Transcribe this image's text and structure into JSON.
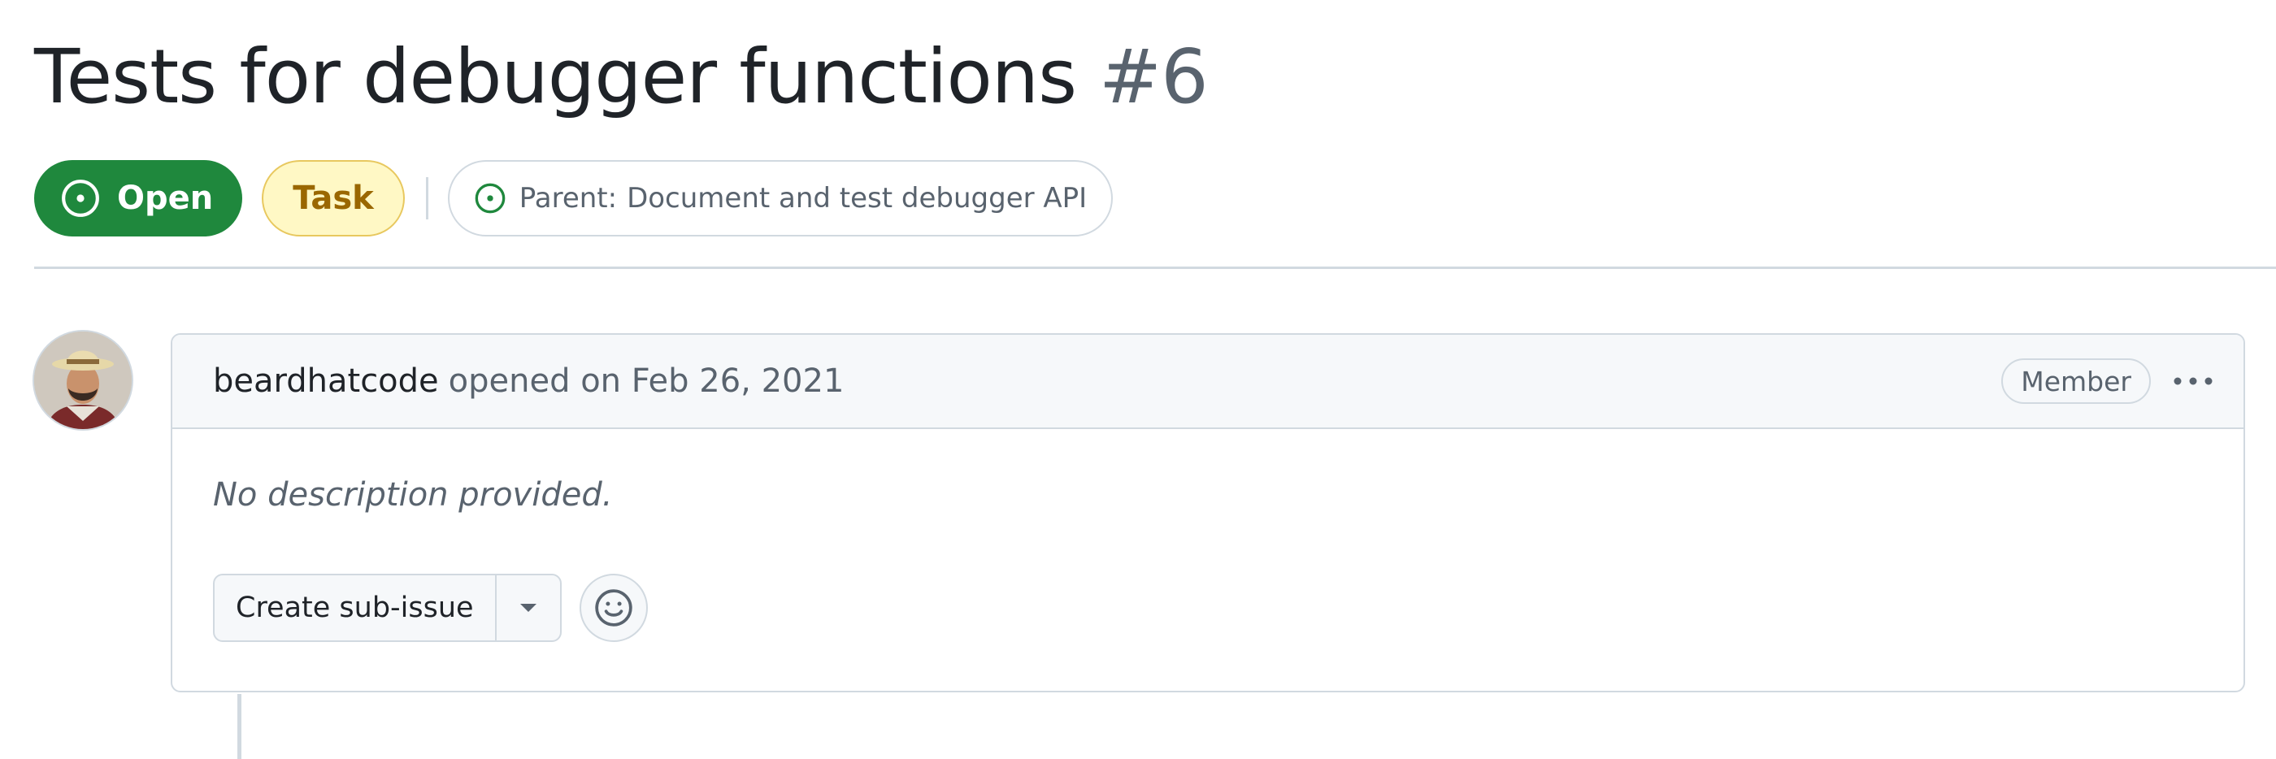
{
  "issue": {
    "title": "Tests for debugger functions",
    "number": "#6",
    "state_label": "Open",
    "type_label": "Task",
    "parent_prefix": "Parent:",
    "parent_title": "Document and test debugger API"
  },
  "comment": {
    "author": "beardhatcode",
    "opened_text": "opened on Feb 26, 2021",
    "role_badge": "Member",
    "body_placeholder": "No description provided.",
    "create_sub_issue_label": "Create sub-issue"
  },
  "icons": {
    "state": "issue-opened-icon",
    "parent": "issue-opened-icon",
    "more": "kebab-horizontal-icon",
    "dropdown": "triangle-down-icon",
    "reaction": "smiley-icon"
  },
  "colors": {
    "open_green": "#1f883d",
    "task_bg": "#fff8c5",
    "task_text": "#9a6700",
    "muted_text": "#59636e",
    "border": "#d1d9e0"
  }
}
